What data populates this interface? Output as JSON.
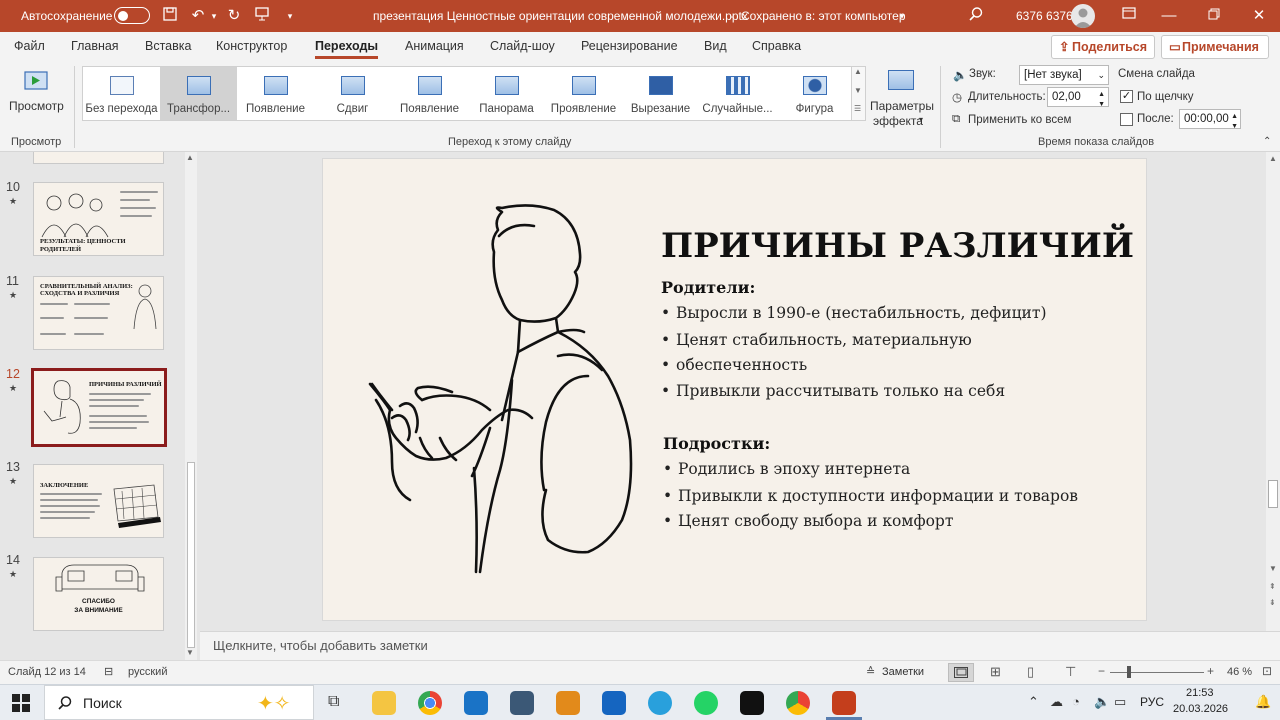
{
  "titlebar": {
    "autosave_label": "Автосохранение",
    "document_title": "презентация Ценностные ориентации современной молодежи.pptx",
    "save_status": "Сохранено в: этот компьютер",
    "user_name": "6376 6376"
  },
  "menu": [
    "Файл",
    "Главная",
    "Вставка",
    "Конструктор",
    "Переходы",
    "Анимация",
    "Слайд-шоу",
    "Рецензирование",
    "Вид",
    "Справка"
  ],
  "menu_active": "Переходы",
  "share_label": "Поделиться",
  "comments_label": "Примечания",
  "ribbon": {
    "preview_label": "Просмотр",
    "preview_group": "Просмотр",
    "transitions": [
      "Без перехода",
      "Трансфор...",
      "Появление",
      "Сдвиг",
      "Появление",
      "Панорама",
      "Проявление",
      "Вырезание",
      "Случайные...",
      "Фигура"
    ],
    "selected_transition": "Трансфор...",
    "transition_group": "Переход к этому слайду",
    "effect_params_line1": "Параметры",
    "effect_params_line2": "эффекта",
    "sound_label": "Звук:",
    "sound_value": "[Нет звука]",
    "duration_label": "Длительность:",
    "duration_value": "02,00",
    "apply_all_label": "Применить ко всем",
    "advance_label": "Смена слайда",
    "on_click_label": "По щелчку",
    "on_click_checked": true,
    "after_label": "После:",
    "after_checked": false,
    "after_value": "00:00,00",
    "timing_group": "Время показа слайдов"
  },
  "thumbnails": [
    {
      "num": "10",
      "title_line1": "РЕЗУЛЬТАТЫ: ЦЕННОСТИ",
      "title_line2": "РОДИТЕЛЕЙ"
    },
    {
      "num": "11",
      "title_line1": "СРАВНИТЕЛЬНЫЙ АНАЛИЗ:",
      "title_line2": "СХОДСТВА И РАЗЛИЧИЯ"
    },
    {
      "num": "12",
      "title_line1": "ПРИЧИНЫ РАЗЛИЧИЙ",
      "title_line2": ""
    },
    {
      "num": "13",
      "title_line1": "ЗАКЛЮЧЕНИЕ",
      "title_line2": ""
    },
    {
      "num": "14",
      "title_line1": "СПАСИБО",
      "title_line2": "ЗА ВНИМАНИЕ"
    }
  ],
  "current_thumbnail": "12",
  "slide": {
    "title": "ПРИЧИНЫ РАЗЛИЧИЙ",
    "parents_heading": "Родители:",
    "parents_items": [
      "Выросли в 1990-е (нестабильность, дефицит)",
      "Ценят стабильность, материальную",
      "обеспеченность",
      "Привыкли рассчитывать только на себя"
    ],
    "teens_heading": "Подростки:",
    "teens_items": [
      "Родились в эпоху интернета",
      "Привыкли к доступности информации и товаров",
      "Ценят свободу выбора и комфорт"
    ]
  },
  "notes_placeholder": "Щелкните, чтобы добавить заметки",
  "status": {
    "slide_info": "Слайд 12 из 14",
    "language": "русский",
    "notes_button": "Заметки",
    "zoom": "46 %",
    "zoom_fraction": 0.46
  },
  "taskbar": {
    "search_label": "Поиск",
    "lang": "РУС",
    "time": "21:53",
    "date": "20.03.2026"
  },
  "colors": {
    "accent": "#b7472a",
    "slide_bg": "#f6f1ea",
    "selected_thumb": "#8b1c1c"
  }
}
